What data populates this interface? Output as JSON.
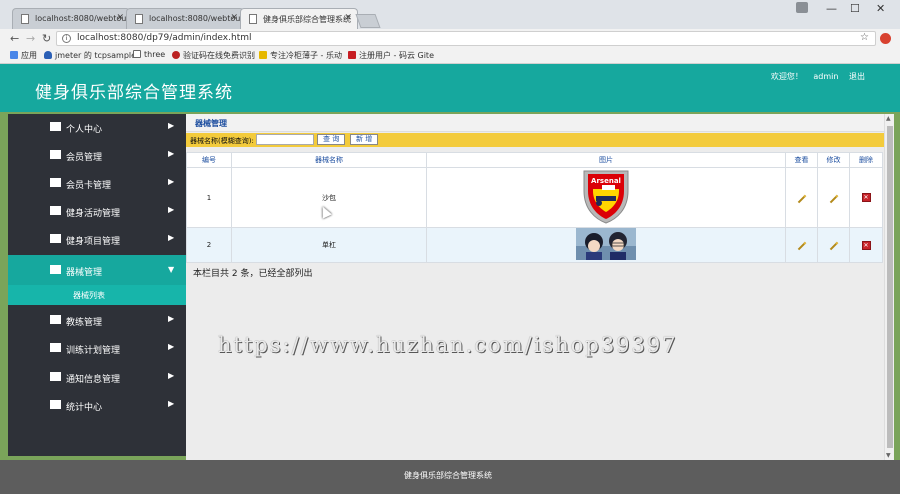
{
  "browser": {
    "tabs": [
      {
        "title": "localhost:8080/webtou",
        "active": false
      },
      {
        "title": "localhost:8080/webtou",
        "active": false
      },
      {
        "title": "健身俱乐部综合管理系统",
        "active": true
      }
    ],
    "url": "localhost:8080/dp79/admin/index.html",
    "bookmarks": [
      {
        "label": "应用",
        "icon": "apps-icon"
      },
      {
        "label": "jmeter 的 tcpsample",
        "icon": "shield-icon"
      },
      {
        "label": "three",
        "icon": "page-icon"
      },
      {
        "label": "验证码在线免费识别",
        "icon": "stamp-icon"
      },
      {
        "label": "专注冷柜薄子 - 乐动",
        "icon": "handshake-icon"
      },
      {
        "label": "注册用户 - 码云 Gite",
        "icon": "gitee-icon"
      }
    ]
  },
  "header": {
    "title": "健身俱乐部综合管理系统",
    "welcome": "欢迎您！",
    "username": "admin",
    "logout": "退出"
  },
  "sidebar": {
    "items": [
      {
        "label": "个人中心"
      },
      {
        "label": "会员管理"
      },
      {
        "label": "会员卡管理"
      },
      {
        "label": "健身活动管理"
      },
      {
        "label": "健身项目管理"
      },
      {
        "label": "器械管理",
        "active": true
      },
      {
        "label": "教练管理"
      },
      {
        "label": "训练计划管理"
      },
      {
        "label": "通知信息管理"
      },
      {
        "label": "统计中心"
      }
    ],
    "submenu_item": "器械列表"
  },
  "main": {
    "section_title": "器械管理",
    "search_label": "器械名称(模糊查询):",
    "search_value": "",
    "query_button": "查 询",
    "add_button": "新 增",
    "columns": [
      "编号",
      "器械名称",
      "图片",
      "查看",
      "修改",
      "删除"
    ],
    "rows": [
      {
        "id": "1",
        "name": "沙包",
        "image": "arsenal-crest-image",
        "image_text": "Arsenal"
      },
      {
        "id": "2",
        "name": "单杠",
        "image": "anime-characters-image"
      }
    ],
    "count_text": "本栏目共 2 条，已经全部列出"
  },
  "watermark": "https://www.huzhan.com/ishop39397",
  "footer": {
    "text": "健身俱乐部综合管理系统"
  }
}
